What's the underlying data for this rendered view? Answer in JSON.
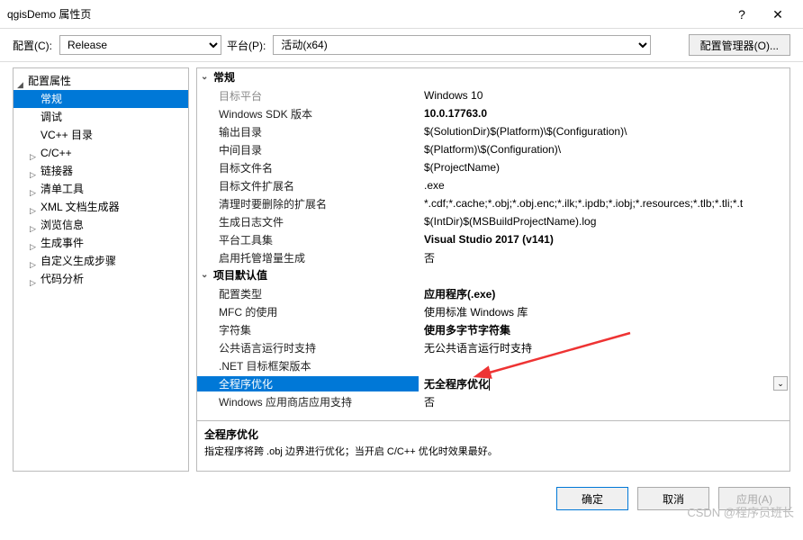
{
  "window": {
    "title": "qgisDemo 属性页",
    "help_btn": "?",
    "close_btn": "✕"
  },
  "topbar": {
    "config_label": "配置(C):",
    "config_value": "Release",
    "platform_label": "平台(P):",
    "platform_value": "活动(x64)",
    "config_mgr": "配置管理器(O)..."
  },
  "tree": {
    "root": "配置属性",
    "items": [
      {
        "label": "常规",
        "sel": true,
        "exp": ""
      },
      {
        "label": "调试",
        "exp": ""
      },
      {
        "label": "VC++ 目录",
        "exp": ""
      },
      {
        "label": "C/C++",
        "exp": "▷"
      },
      {
        "label": "链接器",
        "exp": "▷"
      },
      {
        "label": "清单工具",
        "exp": "▷"
      },
      {
        "label": "XML 文档生成器",
        "exp": "▷"
      },
      {
        "label": "浏览信息",
        "exp": "▷"
      },
      {
        "label": "生成事件",
        "exp": "▷"
      },
      {
        "label": "自定义生成步骤",
        "exp": "▷"
      },
      {
        "label": "代码分析",
        "exp": "▷"
      }
    ]
  },
  "groups": [
    {
      "label": "常规",
      "rows": [
        {
          "key": "目标平台",
          "val": "Windows 10",
          "dim": true
        },
        {
          "key": "Windows SDK 版本",
          "val": "10.0.17763.0",
          "bold": true
        },
        {
          "key": "输出目录",
          "val": "$(SolutionDir)$(Platform)\\$(Configuration)\\"
        },
        {
          "key": "中间目录",
          "val": "$(Platform)\\$(Configuration)\\"
        },
        {
          "key": "目标文件名",
          "val": "$(ProjectName)"
        },
        {
          "key": "目标文件扩展名",
          "val": ".exe"
        },
        {
          "key": "清理时要删除的扩展名",
          "val": "*.cdf;*.cache;*.obj;*.obj.enc;*.ilk;*.ipdb;*.iobj;*.resources;*.tlb;*.tli;*.t"
        },
        {
          "key": "生成日志文件",
          "val": "$(IntDir)$(MSBuildProjectName).log"
        },
        {
          "key": "平台工具集",
          "val": "Visual Studio 2017 (v141)",
          "bold": true
        },
        {
          "key": "启用托管增量生成",
          "val": "否"
        }
      ]
    },
    {
      "label": "项目默认值",
      "rows": [
        {
          "key": "配置类型",
          "val": "应用程序(.exe)",
          "bold": true
        },
        {
          "key": "MFC 的使用",
          "val": "使用标准 Windows 库"
        },
        {
          "key": "字符集",
          "val": "使用多字节字符集",
          "bold": true
        },
        {
          "key": "公共语言运行时支持",
          "val": "无公共语言运行时支持"
        },
        {
          "key": ".NET 目标框架版本",
          "val": ""
        },
        {
          "key": "全程序优化",
          "val": "无全程序优化",
          "bold": true,
          "sel": true,
          "dd": true
        },
        {
          "key": "Windows 应用商店应用支持",
          "val": "否"
        }
      ]
    }
  ],
  "help": {
    "title": "全程序优化",
    "desc": "指定程序将跨 .obj 边界进行优化；当开启 C/C++ 优化时效果最好。"
  },
  "footer": {
    "ok": "确定",
    "cancel": "取消",
    "apply": "应用(A)"
  },
  "watermark": "CSDN @程序员班长"
}
